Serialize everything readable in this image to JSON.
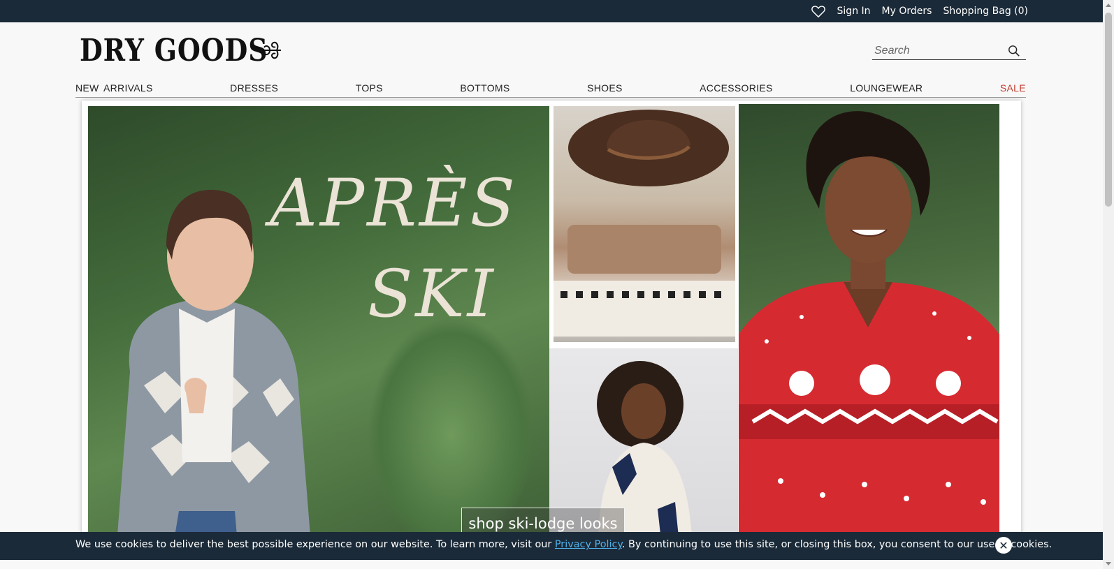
{
  "topbar": {
    "links": [
      {
        "label": "Sign In"
      },
      {
        "label": "My Orders"
      },
      {
        "label": "Shopping Bag (0)"
      }
    ]
  },
  "header": {
    "logo_text": "DRY GOODS",
    "search": {
      "placeholder": "Search"
    }
  },
  "nav": {
    "items": [
      {
        "label": "NEW ARRIVALS"
      },
      {
        "label": "DRESSES"
      },
      {
        "label": "TOPS"
      },
      {
        "label": "BOTTOMS"
      },
      {
        "label": "SHOES"
      },
      {
        "label": "ACCESSORIES"
      },
      {
        "label": "LOUNGEWEAR"
      },
      {
        "label": "SALE"
      }
    ]
  },
  "hero": {
    "headline_line1": "APRÈS",
    "headline_line2": "SKI",
    "cta_label": "shop ski-lodge looks"
  },
  "cookie_banner": {
    "text_before": "We use cookies to deliver the best possible experience on our website. To learn more, visit our ",
    "link_label": "Privacy Policy",
    "text_after": ". By continuing to use this site, or closing this box, you consent to our use of cookies.",
    "close_glyph": "✕"
  },
  "colors": {
    "topbar_bg": "#1b2a38",
    "sale": "#c0392b",
    "link": "#4fb0ea"
  }
}
